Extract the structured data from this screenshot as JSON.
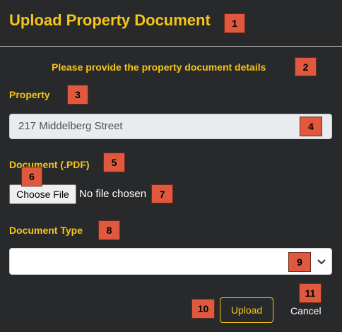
{
  "page": {
    "title": "Upload Property Document",
    "subtitle": "Please provide the property document details"
  },
  "form": {
    "property_label": "Property",
    "property_value": "217 Middelberg Street",
    "document_label": "Document (.PDF)",
    "choose_file_label": "Choose File",
    "no_file_text": "No file chosen",
    "document_type_label": "Document Type",
    "document_type_value": ""
  },
  "actions": {
    "upload_label": "Upload",
    "cancel_label": "Cancel"
  },
  "badges": [
    "1",
    "2",
    "3",
    "4",
    "5",
    "6",
    "7",
    "8",
    "9",
    "10",
    "11"
  ],
  "colors": {
    "accent": "#f5c518",
    "background": "#28292b",
    "badge": "#e0593e"
  }
}
